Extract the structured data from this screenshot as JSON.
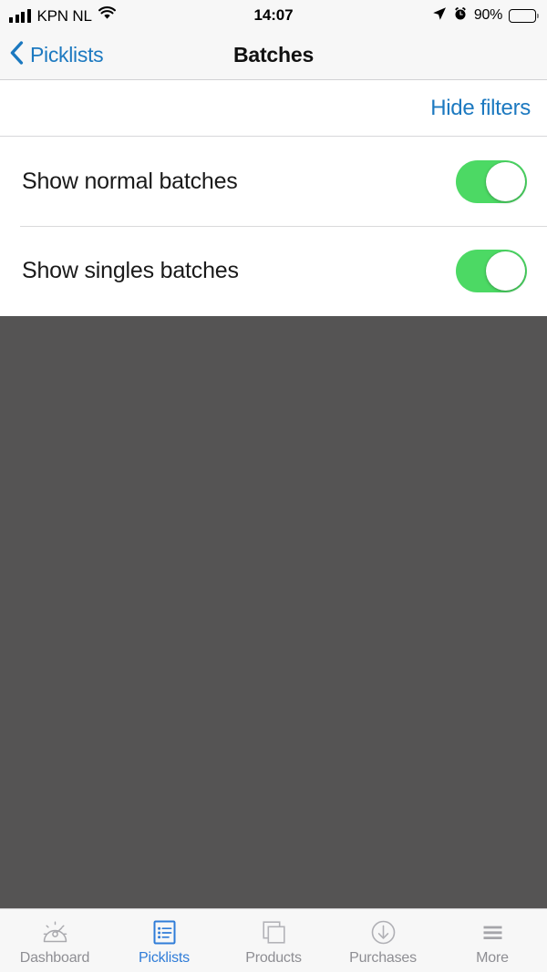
{
  "status_bar": {
    "carrier": "KPN NL",
    "time": "14:07",
    "battery_percent": "90%",
    "icons": {
      "signal": "signal-bars-icon",
      "wifi": "wifi-icon",
      "location": "location-arrow-icon",
      "alarm": "alarm-clock-icon",
      "battery": "battery-icon"
    }
  },
  "nav_bar": {
    "back_label": "Picklists",
    "title": "Batches",
    "back_icon": "chevron-left-icon"
  },
  "filters": {
    "hide_filters_label": "Hide filters",
    "rows": [
      {
        "label": "Show normal batches",
        "value": "on"
      },
      {
        "label": "Show singles batches",
        "value": "on"
      }
    ]
  },
  "tab_bar": {
    "tabs": [
      {
        "label": "Dashboard",
        "icon": "gauge-icon",
        "active": false
      },
      {
        "label": "Picklists",
        "icon": "list-document-icon",
        "active": true
      },
      {
        "label": "Products",
        "icon": "stacked-squares-icon",
        "active": false
      },
      {
        "label": "Purchases",
        "icon": "circle-arrow-down-icon",
        "active": false
      },
      {
        "label": "More",
        "icon": "hamburger-icon",
        "active": false
      }
    ]
  },
  "colors": {
    "accent_blue": "#1c79c0",
    "tab_active_blue": "#2f7cd8",
    "switch_on_green": "#4cd964",
    "overlay_dark": "#555454",
    "bar_background": "#f7f7f7",
    "inactive_gray": "#8e8e93"
  }
}
